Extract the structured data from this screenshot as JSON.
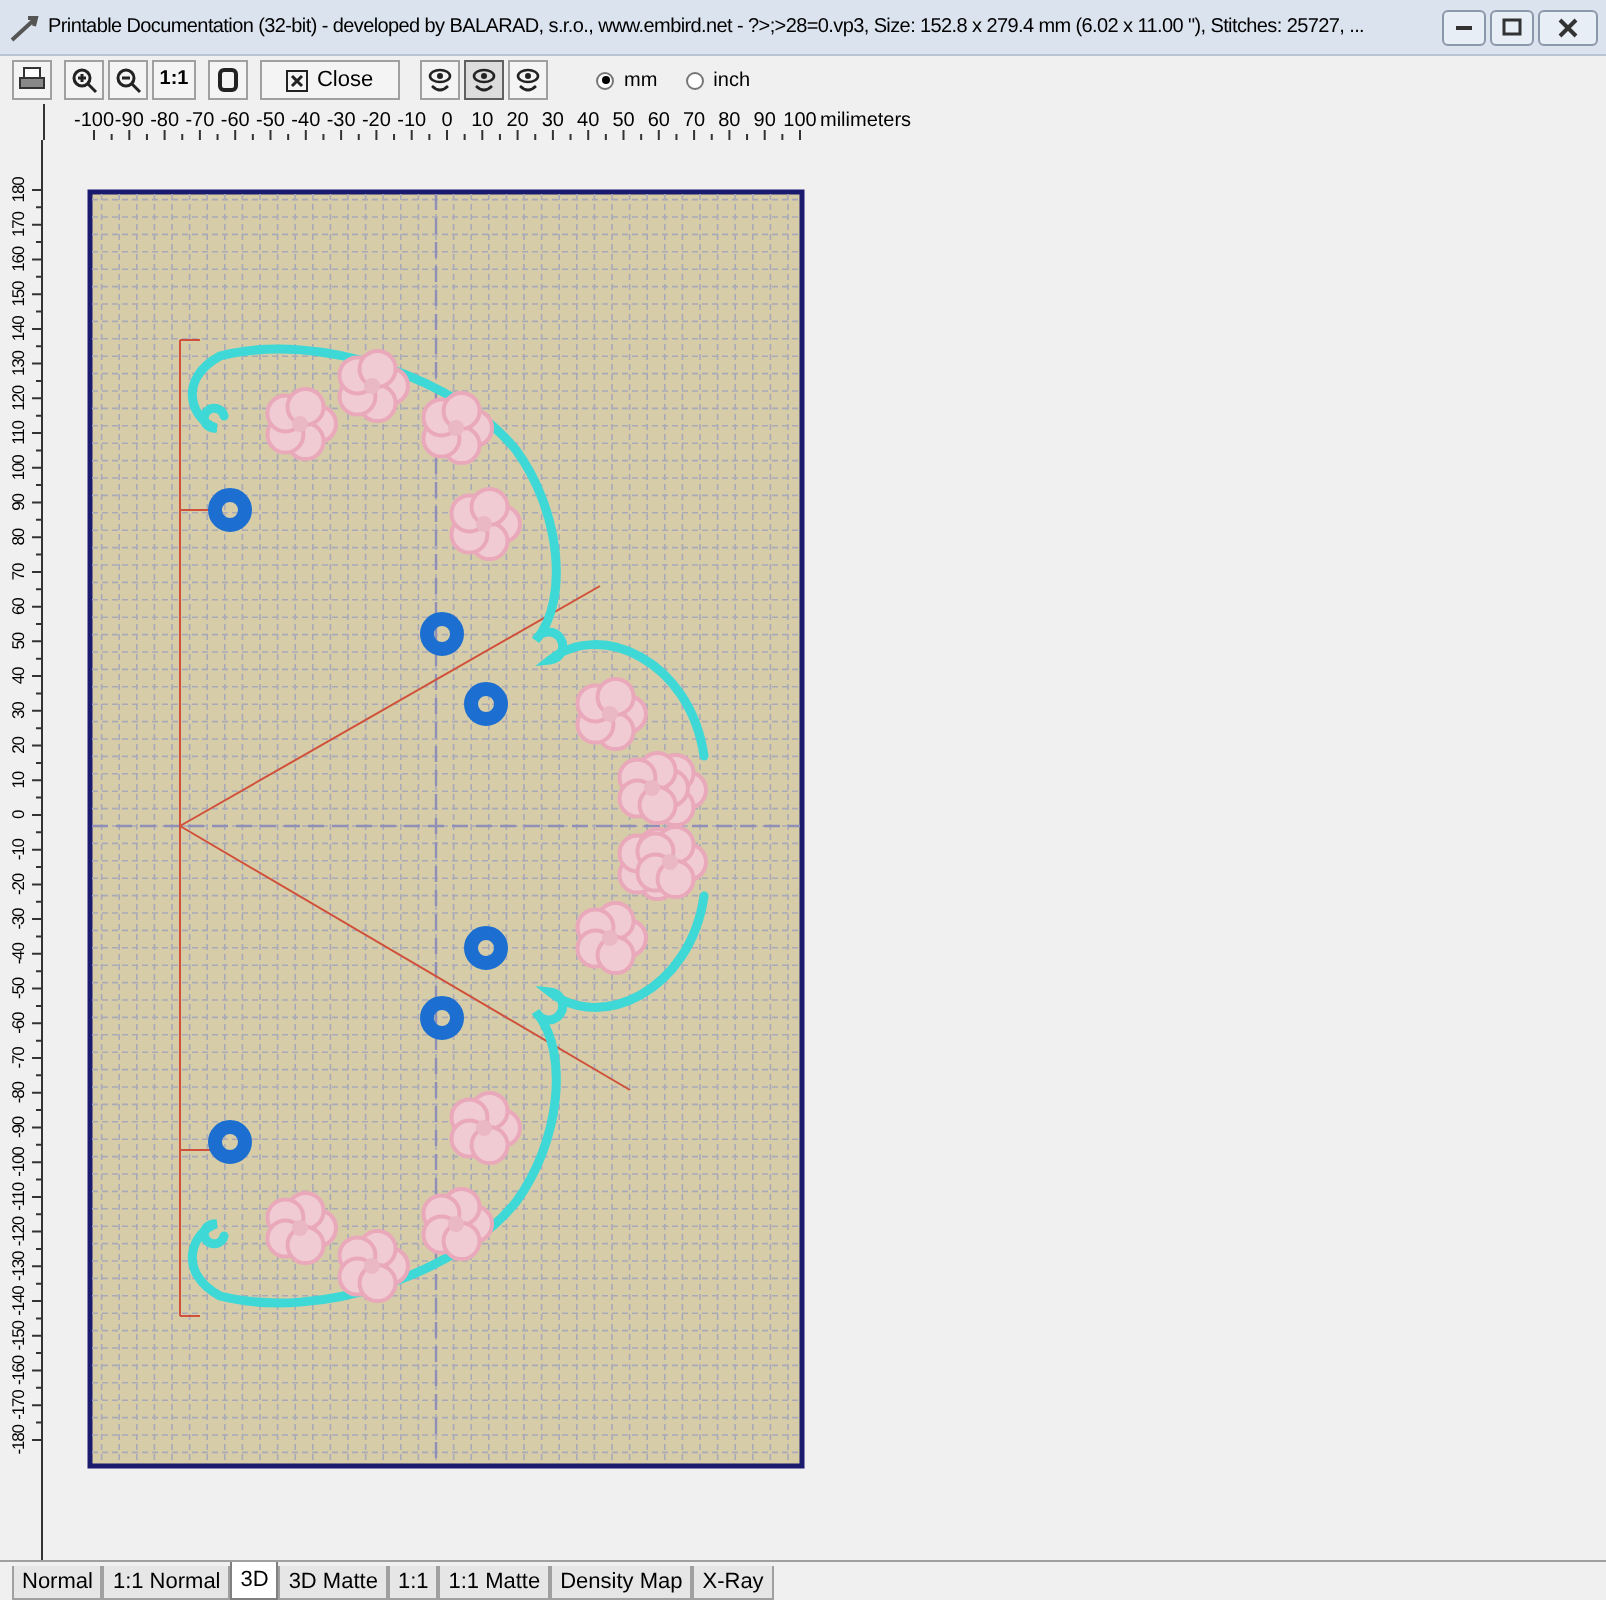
{
  "window": {
    "title": "Printable Documentation (32-bit) - developed by BALARAD, s.r.o., www.embird.net - ?>;>28=0.vp3, Size: 152.8 x 279.4 mm (6.02 x 11.00 \"), Stitches: 25727, ..."
  },
  "toolbar": {
    "scale_button": "1:1",
    "close_button": "Close",
    "view_buttons": [
      {
        "selected": false
      },
      {
        "selected": true
      },
      {
        "selected": false
      }
    ],
    "units": [
      {
        "label": "mm",
        "selected": true
      },
      {
        "label": "inch",
        "selected": false
      }
    ]
  },
  "top_ruler": {
    "labels": [
      "-100",
      "-90",
      "-80",
      "-70",
      "-60",
      "-50",
      "-40",
      "-30",
      "-20",
      "-10",
      "0",
      "10",
      "20",
      "30",
      "40",
      "50",
      "60",
      "70",
      "80",
      "90",
      "100"
    ],
    "unit": "milimeters"
  },
  "left_ruler": {
    "labels": [
      "180",
      "170",
      "160",
      "150",
      "140",
      "130",
      "120",
      "110",
      "100",
      "90",
      "80",
      "70",
      "60",
      "50",
      "40",
      "30",
      "20",
      "10",
      "0",
      "-10",
      "-20",
      "-30",
      "-40",
      "-50",
      "-60",
      "-70",
      "-80",
      "-90",
      "-100",
      "-110",
      "-120",
      "-130",
      "-140",
      "-150",
      "-160",
      "-170",
      "-180"
    ]
  },
  "tabs": [
    {
      "label": "Normal",
      "selected": false
    },
    {
      "label": "1:1 Normal",
      "selected": false
    },
    {
      "label": "3D",
      "selected": true
    },
    {
      "label": "3D Matte",
      "selected": false
    },
    {
      "label": "1:1",
      "selected": false
    },
    {
      "label": "1:1 Matte",
      "selected": false
    },
    {
      "label": "Density Map",
      "selected": false
    },
    {
      "label": "X-Ray",
      "selected": false
    }
  ]
}
